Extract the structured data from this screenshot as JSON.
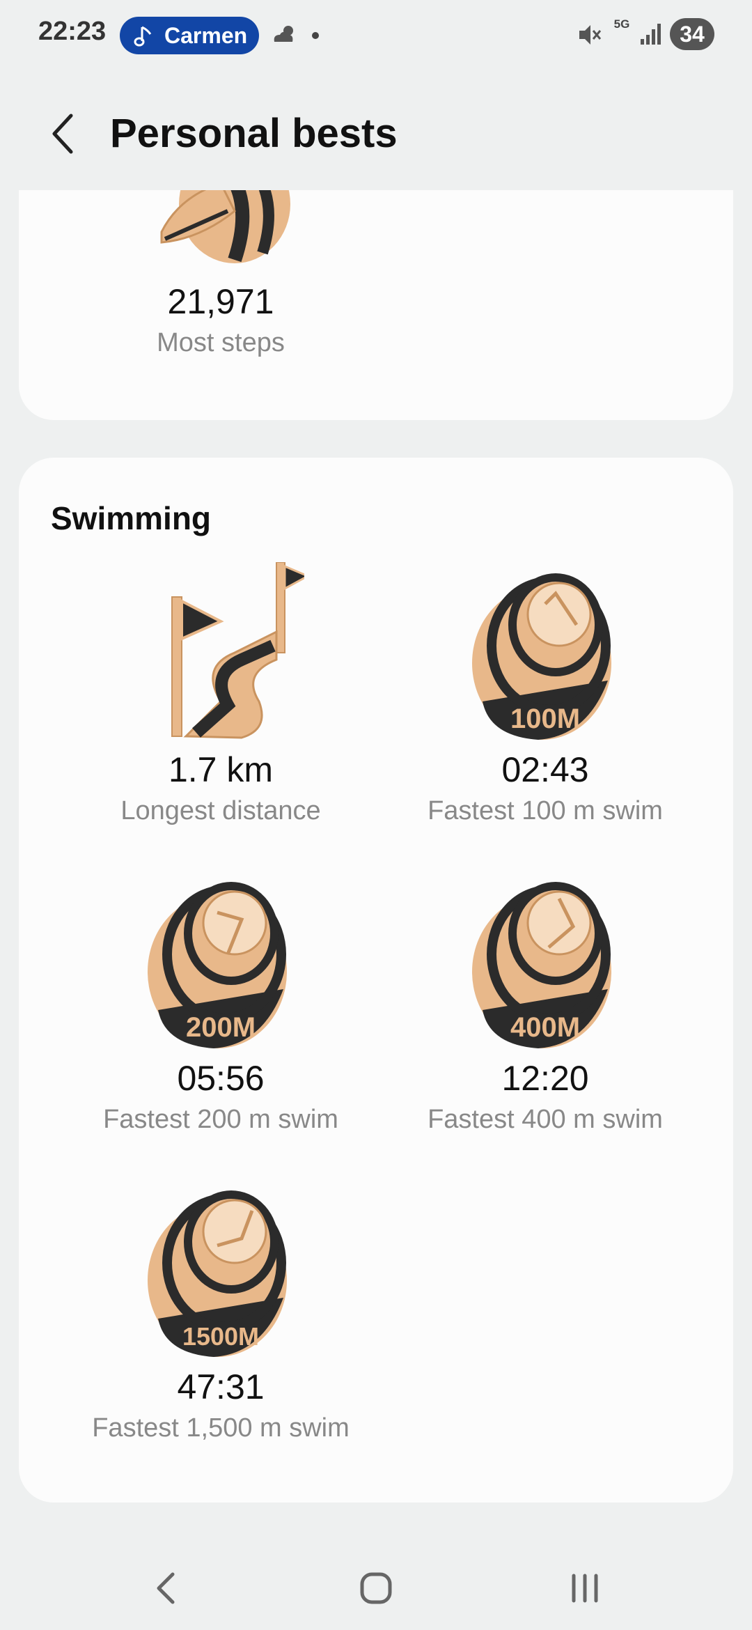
{
  "status_bar": {
    "time": "22:23",
    "pill_label": "Carmen",
    "network": "5G",
    "battery": "34",
    "icons": [
      "music-note-icon",
      "weather-icon",
      "mute-icon",
      "signal-icon"
    ]
  },
  "header": {
    "title": "Personal bests",
    "back_icon": "back-arrow-icon"
  },
  "steps_card": {
    "value": "21,971",
    "label": "Most steps"
  },
  "swimming": {
    "title": "Swimming",
    "items": [
      {
        "value": "1.7 km",
        "label": "Longest distance",
        "badge": "distance-flags"
      },
      {
        "value": "02:43",
        "label": "Fastest 100 m swim",
        "badge": "100M"
      },
      {
        "value": "05:56",
        "label": "Fastest 200 m swim",
        "badge": "200M"
      },
      {
        "value": "12:20",
        "label": "Fastest 400 m swim",
        "badge": "400M"
      },
      {
        "value": "47:31",
        "label": "Fastest 1,500 m swim",
        "badge": "1500M"
      }
    ]
  },
  "colors": {
    "accent_pill": "#1246a6",
    "badge_gold": "#e8b88a",
    "badge_dark": "#2b2b2b",
    "background": "#eef0f0",
    "card": "#fcfcfc"
  },
  "nav_bar": {
    "icons": [
      "nav-back-icon",
      "nav-home-icon",
      "nav-recents-icon"
    ]
  }
}
